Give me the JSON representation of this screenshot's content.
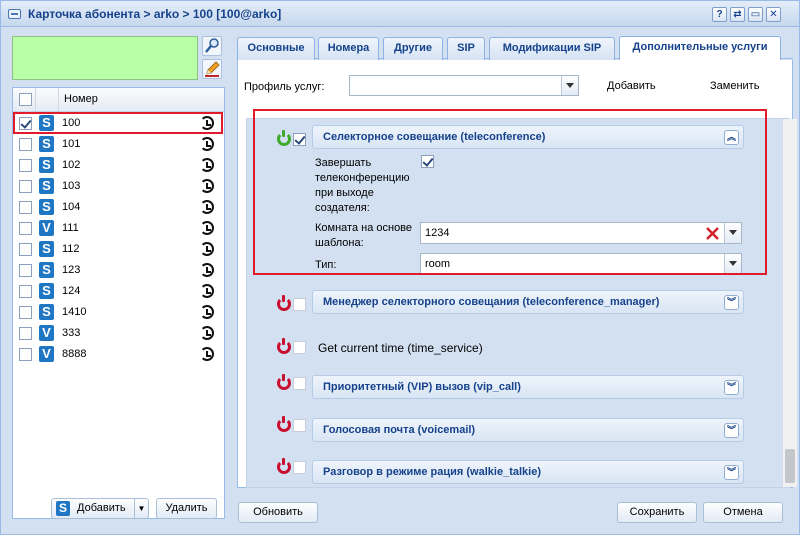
{
  "window": {
    "title": "Карточка абонента > arko > 100 [100@arko]",
    "buttons": [
      "?",
      "⇄",
      "▭",
      "✕"
    ]
  },
  "left": {
    "grid_header": "Номер",
    "rows": [
      {
        "num": "100",
        "type": "S",
        "checked": true
      },
      {
        "num": "101",
        "type": "S",
        "checked": false
      },
      {
        "num": "102",
        "type": "S",
        "checked": false
      },
      {
        "num": "103",
        "type": "S",
        "checked": false
      },
      {
        "num": "104",
        "type": "S",
        "checked": false
      },
      {
        "num": "111",
        "type": "V",
        "checked": false
      },
      {
        "num": "112",
        "type": "S",
        "checked": false
      },
      {
        "num": "123",
        "type": "S",
        "checked": false
      },
      {
        "num": "124",
        "type": "S",
        "checked": false
      },
      {
        "num": "1410",
        "type": "S",
        "checked": false
      },
      {
        "num": "333",
        "type": "V",
        "checked": false
      },
      {
        "num": "8888",
        "type": "V",
        "checked": false
      }
    ],
    "add_label": "Добавить",
    "delete_label": "Удалить"
  },
  "tabs": [
    "Основные",
    "Номера",
    "Другие",
    "SIP",
    "Модификации SIP",
    "Дополнительные услуги"
  ],
  "profile": {
    "label": "Профиль услуг:",
    "value": "",
    "add": "Добавить",
    "replace": "Заменить"
  },
  "services": {
    "teleconference": {
      "title": "Селекторное совещание (teleconference)",
      "end_label": "Завершать телеконференцию при выходе создателя:",
      "room_label": "Комната на основе шаблона:",
      "room_value": "1234",
      "type_label": "Тип:",
      "type_value": "room"
    },
    "manager": "Менеджер селекторного совещания (teleconference_manager)",
    "time_service": "Get current time (time_service)",
    "vip": "Приоритетный (VIP) вызов (vip_call)",
    "voicemail": "Голосовая почта (voicemail)",
    "walkie": "Разговор в режиме рация (walkie_talkie)"
  },
  "footer": {
    "refresh": "Обновить",
    "save": "Сохранить",
    "cancel": "Отмена"
  },
  "colors": {
    "highlight": "#e01c2c",
    "power_on": "#3faa2c",
    "power_off": "#c8102e",
    "s_icon": "#1f77c4"
  }
}
